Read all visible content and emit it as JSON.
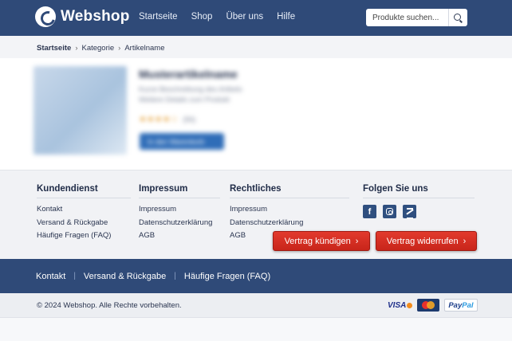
{
  "header": {
    "brand": "Webshop",
    "nav": [
      "Startseite",
      "Shop",
      "Über uns",
      "Hilfe"
    ],
    "search_placeholder": "Produkte suchen..."
  },
  "breadcrumb": [
    "Startseite",
    "Kategorie",
    "Artikelname"
  ],
  "product": {
    "title": "Musterartikelname",
    "line1": "Kurze Beschreibung des Artikels",
    "line2": "Weitere Details zum Produkt",
    "rating_stars": "★★★★☆",
    "rating_count": "(56)",
    "cart_label": "In den Warenkorb"
  },
  "footer": {
    "columns": [
      {
        "title": "Kundendienst",
        "items": [
          "Kontakt",
          "Versand & Rückgabe",
          "Häufige Fragen (FAQ)"
        ]
      },
      {
        "title": "Impressum",
        "items": [
          "Impressum",
          "Datenschutzerklärung",
          "AGB"
        ]
      },
      {
        "title": "Rechtliches",
        "items": [
          "Impressum",
          "Datenschutzerklärung",
          "AGB"
        ]
      },
      {
        "title": "Folgen Sie uns",
        "social": [
          "facebook-icon",
          "instagram-icon",
          "xing-icon"
        ]
      }
    ],
    "buttons": {
      "kuendigen": "Vertrag kündigen",
      "widerrufen": "Vertrag widerrufen"
    },
    "nav": [
      "Kontakt",
      "Versand & Rückgabe",
      "Häufige Fragen (FAQ)"
    ],
    "copyright": "© 2024 Webshop. Alle Rechte vorbehalten.",
    "payments": {
      "visa": "VISA",
      "paypal_a": "Pay",
      "paypal_b": "Pal"
    }
  },
  "colors": {
    "header_bg": "#2f4a78",
    "button_red": "#d42e22",
    "primary_blue": "#2f6db8"
  }
}
